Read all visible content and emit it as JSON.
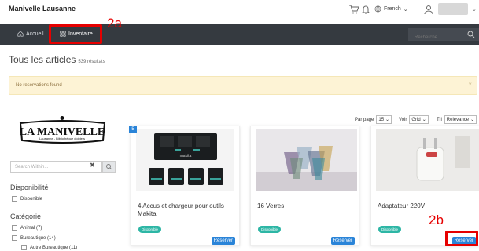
{
  "header": {
    "brand": "Manivelle Lausanne",
    "language": "French"
  },
  "nav": {
    "home_label": "Accueil",
    "inventory_label": "Inventaire",
    "search_placeholder": "Recherche..."
  },
  "annotations": {
    "a": "2a",
    "b": "2b"
  },
  "page": {
    "title": "Tous les articles",
    "count": "539 résultats"
  },
  "alert": {
    "text": "No reservations found",
    "close": "×"
  },
  "logo": {
    "line1": "LA MANIVELLE",
    "line2": "Lausanne - Bibliothèque d'objets"
  },
  "sidebar": {
    "search_placeholder": "Search Within...",
    "clear": "✖",
    "availability_heading": "Disponibilité",
    "availability_option": "Disponible",
    "category_heading": "Catégorie",
    "categories": [
      "Animal (7)",
      "Bureautique (14)",
      "Autre Bureautique (11)"
    ]
  },
  "toolbar": {
    "per_page_label": "Par page",
    "per_page_value": "15",
    "view_label": "Voir",
    "view_value": "Grid",
    "sort_label": "Tri",
    "sort_value": "Relevance"
  },
  "items": [
    {
      "count": "5",
      "title": "4 Accus et chargeur pour outils Makita",
      "status": "Disponible",
      "action": "Réserver",
      "image_text": "makita"
    },
    {
      "title": "16 Verres",
      "status": "Disponible",
      "action": "Réserver"
    },
    {
      "title": "Adaptateur 220V",
      "status": "Disponible",
      "action": "Réserver"
    }
  ],
  "colors": {
    "navbar": "#353a40",
    "accent": "#2a84d8",
    "badge": "#2db6a5",
    "annotation": "#e60000",
    "alert_bg": "#fdf3d5"
  }
}
